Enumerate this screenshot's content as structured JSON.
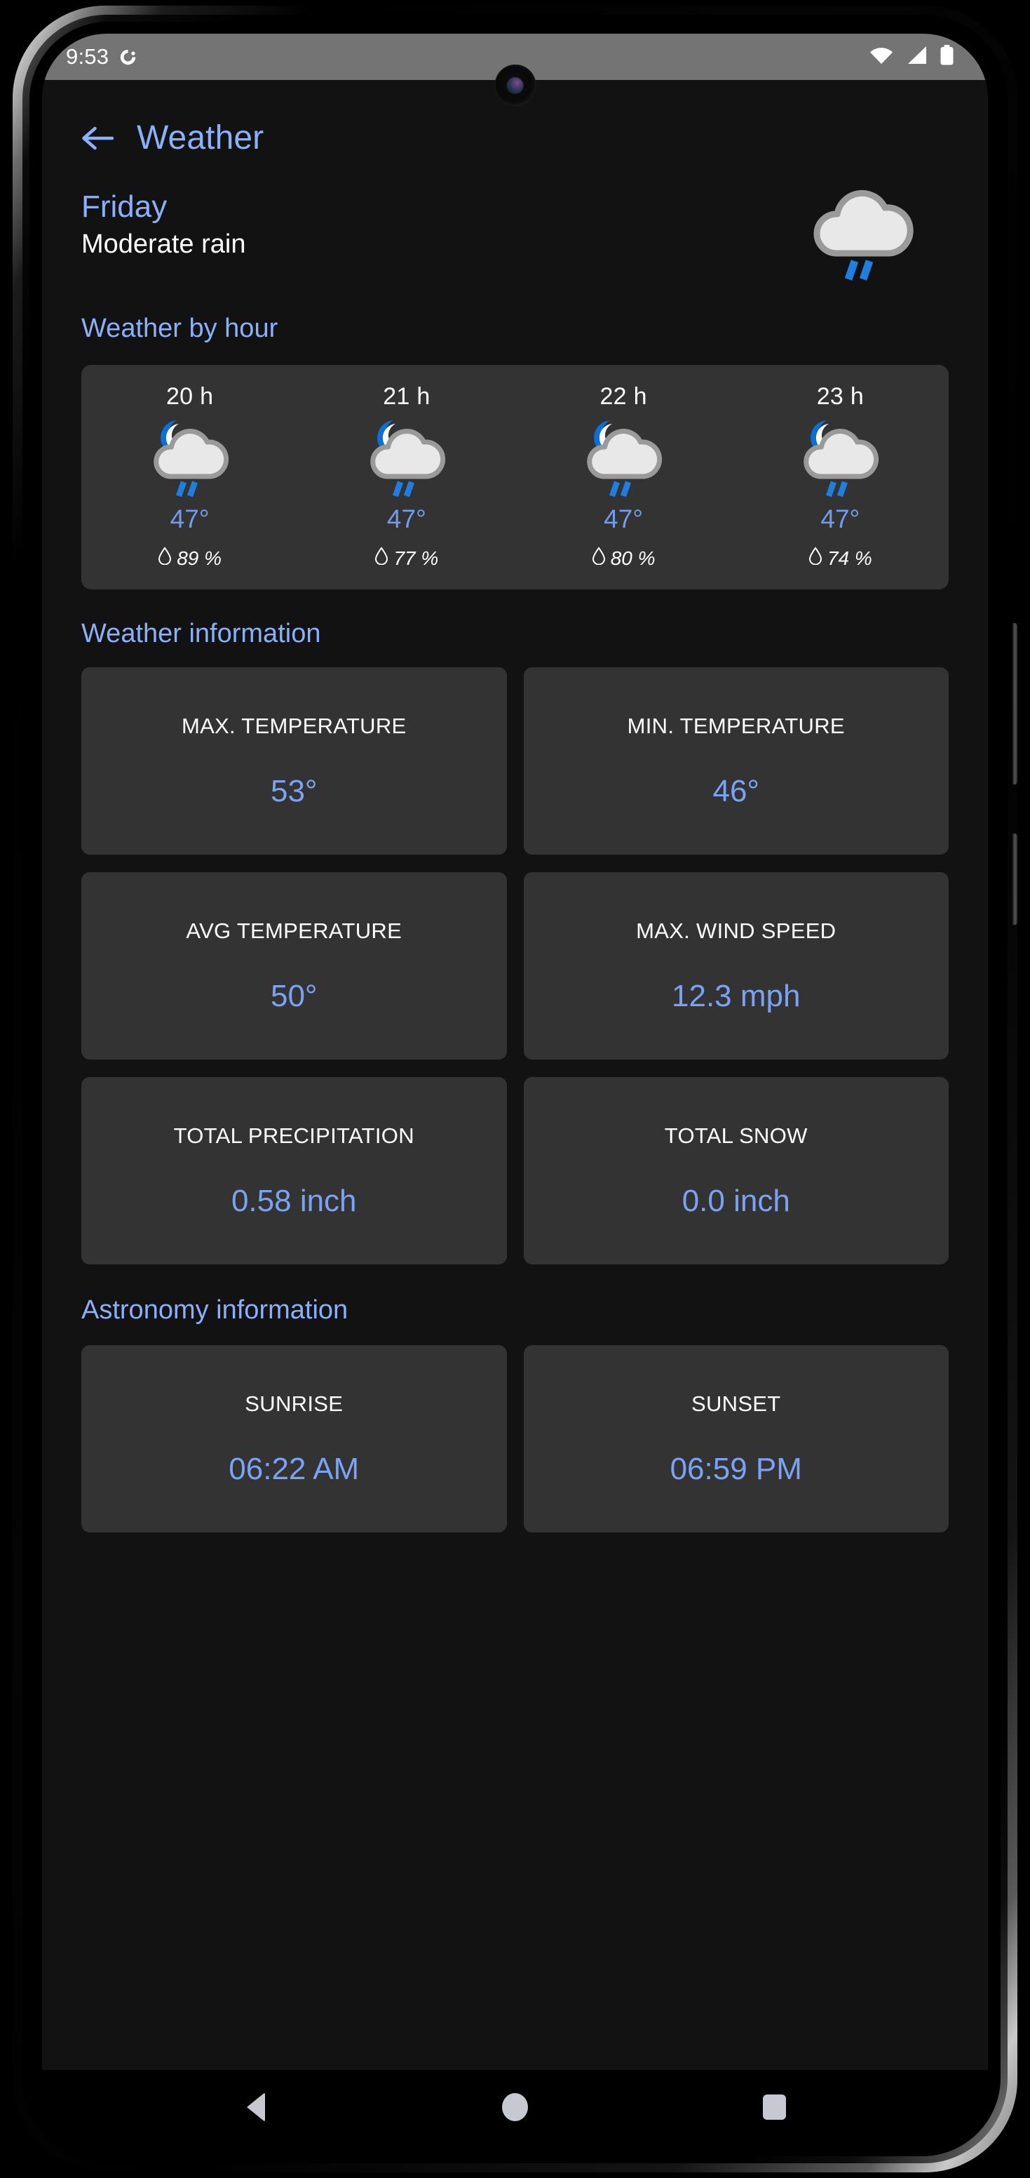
{
  "status_bar": {
    "clock": "9:53",
    "badge_icon": "circular-sync-icon",
    "wifi_icon": "wifi-icon",
    "signal_icon": "cell-signal-icon",
    "battery_icon": "battery-full-icon"
  },
  "app_bar": {
    "back_icon": "back-arrow-icon",
    "title": "Weather"
  },
  "day_summary": {
    "day": "Friday",
    "condition": "Moderate rain",
    "icon": "cloud-rain-icon"
  },
  "sections": {
    "weather_by_hour": "Weather by hour",
    "weather_information": "Weather information",
    "astronomy_information": "Astronomy information"
  },
  "hourly": [
    {
      "hour": "20 h",
      "icon": "moon-cloud-rain-icon",
      "temp": "47°",
      "humidity": "89 %",
      "drop_icon": "water-drop-icon"
    },
    {
      "hour": "21 h",
      "icon": "moon-cloud-rain-icon",
      "temp": "47°",
      "humidity": "77 %",
      "drop_icon": "water-drop-icon"
    },
    {
      "hour": "22 h",
      "icon": "moon-cloud-rain-icon",
      "temp": "47°",
      "humidity": "80 %",
      "drop_icon": "water-drop-icon"
    },
    {
      "hour": "23 h",
      "icon": "moon-cloud-rain-icon",
      "temp": "47°",
      "humidity": "74 %",
      "drop_icon": "water-drop-icon"
    }
  ],
  "weather_info": [
    {
      "label": "MAX. TEMPERATURE",
      "value": "53°"
    },
    {
      "label": "MIN. TEMPERATURE",
      "value": "46°"
    },
    {
      "label": "AVG TEMPERATURE",
      "value": "50°"
    },
    {
      "label": "MAX. WIND SPEED",
      "value": "12.3 mph"
    },
    {
      "label": "TOTAL PRECIPITATION",
      "value": "0.58 inch"
    },
    {
      "label": "TOTAL SNOW",
      "value": "0.0 inch"
    }
  ],
  "astronomy_info": [
    {
      "label": "SUNRISE",
      "value": "06:22 AM"
    },
    {
      "label": "SUNSET",
      "value": "06:59 PM"
    }
  ],
  "nav_bar": {
    "back": "nav-back-icon",
    "home": "nav-home-icon",
    "recents": "nav-recents-icon"
  },
  "colors": {
    "accent_blue": "#8ab0fb",
    "value_blue": "#7ba3f5",
    "card_bg": "#333333",
    "screen_bg": "#121212",
    "rain_blue": "#1f7fe0",
    "moon_blue": "#0b6fd4",
    "cloud_fill": "#e8e8e8",
    "cloud_stroke": "#9a9a9a"
  }
}
